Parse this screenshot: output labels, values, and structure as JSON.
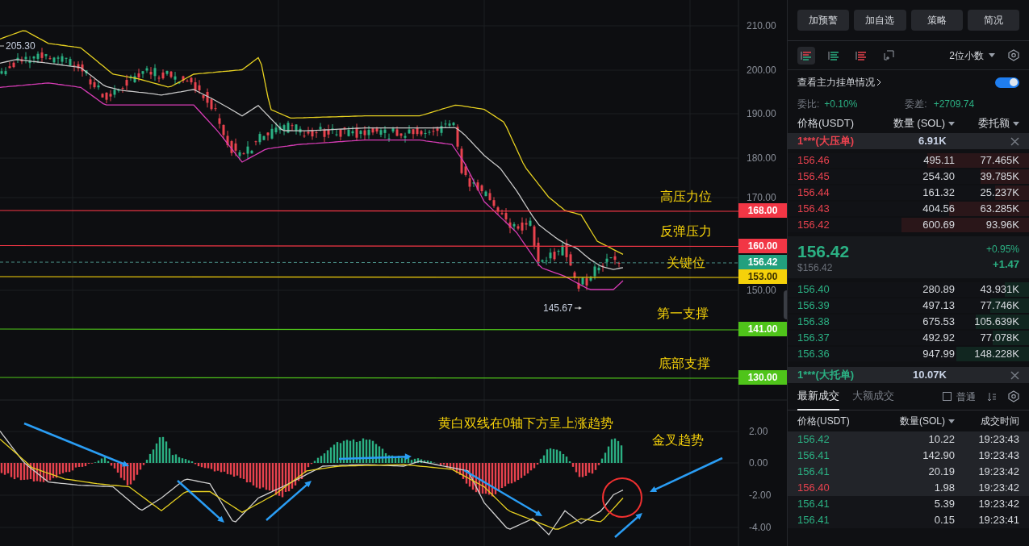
{
  "price_axis": {
    "ticks": [
      "210.00",
      "200.00",
      "190.00",
      "180.00",
      "170.00",
      "150.00"
    ]
  },
  "macd_axis": {
    "ticks": [
      "2.00",
      "0.00",
      "-2.00",
      "-4.00"
    ]
  },
  "high_label": "205.30",
  "low_label": "145.67",
  "last_price_tag": "156.42",
  "levels": [
    {
      "label": "高压力位",
      "price": "168.00",
      "color": "#f23645"
    },
    {
      "label": "反弹压力",
      "price": "160.00",
      "color": "#f23645"
    },
    {
      "label": "关键位",
      "price": "153.00",
      "color": "#f5d10a"
    },
    {
      "label": "第一支撑",
      "price": "141.00",
      "color": "#4fc41a"
    },
    {
      "label": "底部支撑",
      "price": "130.00",
      "color": "#4fc41a"
    }
  ],
  "annotations": [
    "黄白双线在0轴下方呈上涨趋势",
    "金叉趋势"
  ],
  "panel": {
    "actions": [
      "加预警",
      "加自选",
      "策略",
      "简况"
    ],
    "view_modes": [
      {
        "kind": "both",
        "selected": true
      },
      {
        "kind": "bids",
        "selected": false
      },
      {
        "kind": "asks",
        "selected": false
      },
      {
        "kind": "custom",
        "selected": false
      }
    ],
    "decimals": "2位小数",
    "main_orders": {
      "label": "查看主力挂单情况",
      "on": true
    },
    "ratio": {
      "label": "委比:",
      "value": "+0.10%"
    },
    "diff": {
      "label": "委差:",
      "value": "+2709.74"
    },
    "columns": [
      "价格(USDT)",
      "数量 (SOL)",
      "委托额"
    ],
    "big_ask": {
      "label": "1***(大压单)",
      "amount": "6.91K"
    },
    "asks": [
      {
        "price": "156.46",
        "qty": "495.11",
        "total": "77.465K",
        "level": 0.42
      },
      {
        "price": "156.45",
        "qty": "254.30",
        "total": "39.785K",
        "level": 0.2
      },
      {
        "price": "156.44",
        "qty": "161.32",
        "total": "25.237K",
        "level": 0.14
      },
      {
        "price": "156.43",
        "qty": "404.56",
        "total": "63.285K",
        "level": 0.33
      },
      {
        "price": "156.42",
        "qty": "600.69",
        "total": "93.96K",
        "level": 0.53
      }
    ],
    "mid": {
      "price": "156.42",
      "usd": "$156.42",
      "change_pct": "+0.95%",
      "change": "+1.47"
    },
    "bids": [
      {
        "price": "156.40",
        "qty": "280.89",
        "total": "43.931K",
        "level": 0.1
      },
      {
        "price": "156.39",
        "qty": "497.13",
        "total": "77.746K",
        "level": 0.16
      },
      {
        "price": "156.38",
        "qty": "675.53",
        "total": "105.639K",
        "level": 0.22
      },
      {
        "price": "156.37",
        "qty": "492.92",
        "total": "77.078K",
        "level": 0.15
      },
      {
        "price": "156.36",
        "qty": "947.99",
        "total": "148.228K",
        "level": 0.3
      }
    ],
    "big_bid": {
      "label": "1***(大托单)",
      "amount": "10.07K"
    },
    "trade_tabs": [
      {
        "label": "最新成交",
        "selected": true
      },
      {
        "label": "大额成交",
        "selected": false
      }
    ],
    "normal_filter": {
      "label": "普通",
      "checked": false
    },
    "trade_columns": [
      "价格(USDT)",
      "数量(SOL)",
      "成交时间"
    ],
    "trades": [
      {
        "price": "156.42",
        "qty": "10.22",
        "time": "19:23:43",
        "color": "#2bb083",
        "fresh": true
      },
      {
        "price": "156.41",
        "qty": "142.90",
        "time": "19:23:43",
        "color": "#2bb083",
        "fresh": true
      },
      {
        "price": "156.41",
        "qty": "20.19",
        "time": "19:23:42",
        "color": "#2bb083",
        "fresh": true
      },
      {
        "price": "156.40",
        "qty": "1.98",
        "time": "19:23:42",
        "color": "#e8424e",
        "fresh": true
      },
      {
        "price": "156.41",
        "qty": "5.39",
        "time": "19:23:42",
        "color": "#2bb083",
        "fresh": false
      },
      {
        "price": "156.41",
        "qty": "0.15",
        "time": "19:23:41",
        "color": "#2bb083",
        "fresh": false
      }
    ]
  }
}
